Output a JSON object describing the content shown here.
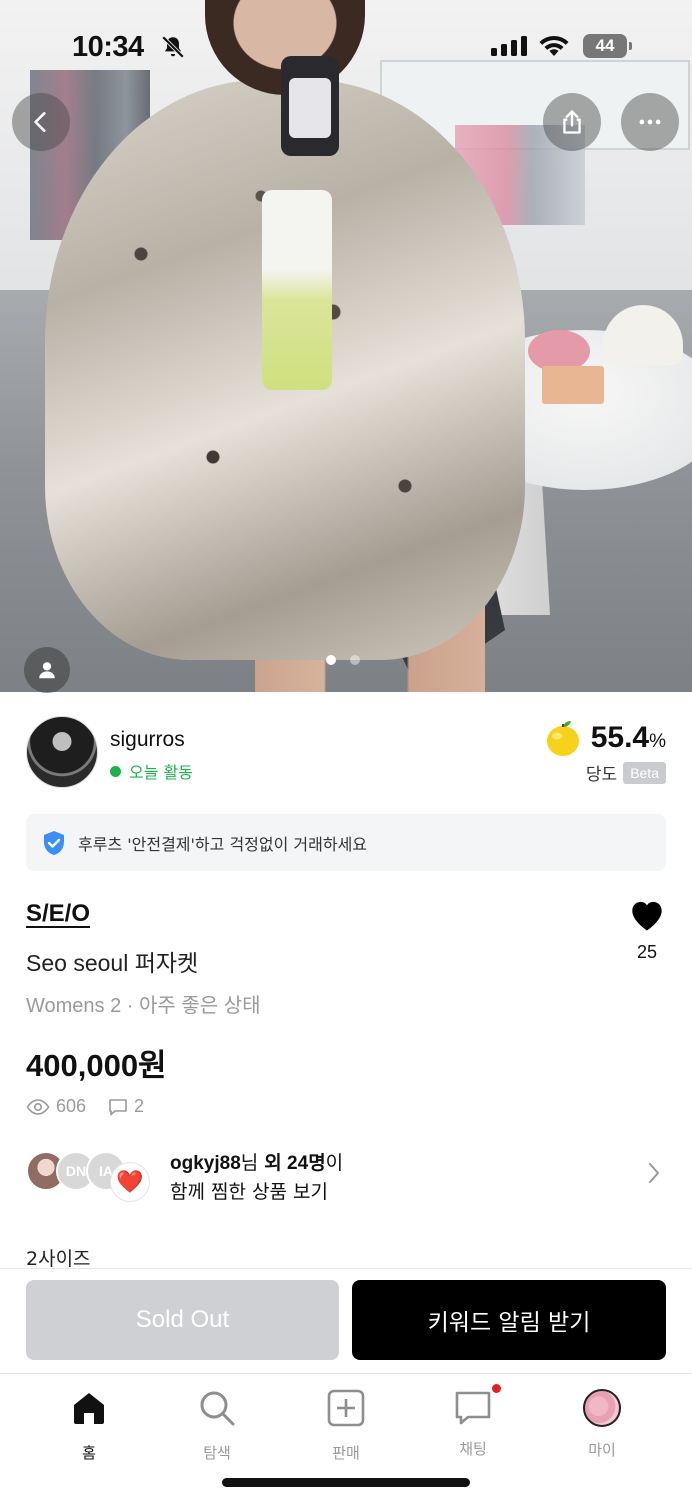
{
  "status_bar": {
    "time": "10:34",
    "battery": "44",
    "icons": [
      "bell-slash-icon",
      "signal-icon",
      "wifi-icon",
      "battery-icon"
    ]
  },
  "top_nav": {
    "icons": [
      "chevron-left-icon",
      "share-icon",
      "more-icon"
    ]
  },
  "gallery": {
    "current_page": 1,
    "total_pages": 2
  },
  "seller": {
    "name": "sigurros",
    "activity": "오늘 활동",
    "score_value": "55.4",
    "score_unit": "%",
    "score_label": "당도",
    "score_badge": "Beta"
  },
  "safe_pay": {
    "text": "후루츠 '안전결제'하고 걱정없이 거래하세요"
  },
  "product": {
    "brand": "S/E/O",
    "title": "Seo seoul 퍼자켓",
    "meta": "Womens 2 · 아주 좋은 상태",
    "price": "400,000원",
    "views": "606",
    "comments": "2",
    "likes": "25"
  },
  "likers": {
    "avatar2": "DN",
    "avatar3": "IA",
    "avatar4": "❤️",
    "user": "ogkyj88",
    "suffix1": "님 ",
    "others": "외 24명",
    "suffix2": "이",
    "line2": "함께 찜한 상품 보기"
  },
  "size_section": {
    "label": "2사이즈"
  },
  "actions": {
    "sold_out": "Sold Out",
    "keyword_alert": "키워드 알림 받기"
  },
  "tabs": [
    {
      "label": "홈",
      "icon": "home-icon",
      "active": true
    },
    {
      "label": "탐색",
      "icon": "search-icon",
      "active": false
    },
    {
      "label": "판매",
      "icon": "plus-square-icon",
      "active": false
    },
    {
      "label": "채팅",
      "icon": "chat-icon",
      "active": false
    },
    {
      "label": "마이",
      "icon": "avatar",
      "active": false
    }
  ],
  "colors": {
    "accent_green": "#1fb24a",
    "primary_black": "#000000",
    "disabled_gray": "#cfd0d3",
    "notify_red": "#e52020"
  }
}
